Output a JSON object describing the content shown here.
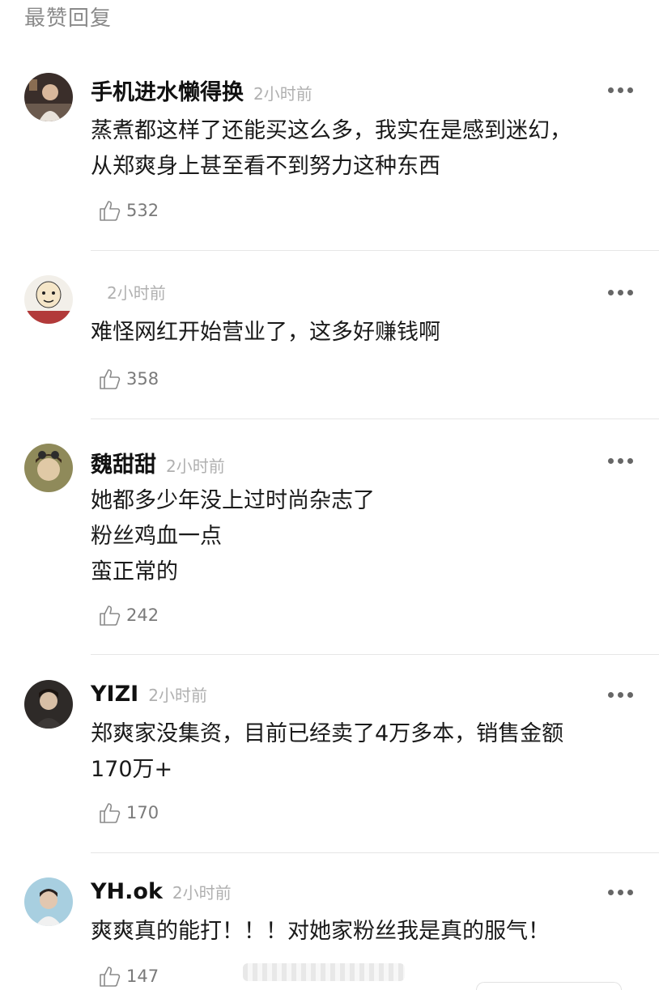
{
  "section_header": "最赞回复",
  "comments": [
    {
      "username": "手机进水懒得换",
      "time": "2小时前",
      "lines": [
        "蒸煮都这样了还能买这么多，我实在是感到迷幻，",
        "从郑爽身上甚至看不到努力这种东西"
      ],
      "likes": "532"
    },
    {
      "username": "",
      "time": "2小时前",
      "lines": [
        "难怪网红开始营业了，这多好赚钱啊"
      ],
      "likes": "358"
    },
    {
      "username": "魏甜甜",
      "time": "2小时前",
      "lines": [
        "她都多少年没上过时尚杂志了",
        "粉丝鸡血一点",
        "蛮正常的"
      ],
      "likes": "242"
    },
    {
      "username": "YIZI",
      "time": "2小时前",
      "lines": [
        "郑爽家没集资，目前已经卖了4万多本，销售金额",
        "170万+"
      ],
      "likes": "170"
    },
    {
      "username": "YH.ok",
      "time": "2小时前",
      "lines": [
        "爽爽真的能打！！！对她家粉丝我是真的服气！"
      ],
      "likes": "147"
    }
  ],
  "icons": {
    "like": "thumbs-up-outline-icon",
    "more": "more-dots-icon"
  },
  "colors": {
    "text": "#1a1a1a",
    "muted": "#b0b0b0",
    "header": "#8a8a8a",
    "divider": "#e6e6e6"
  }
}
